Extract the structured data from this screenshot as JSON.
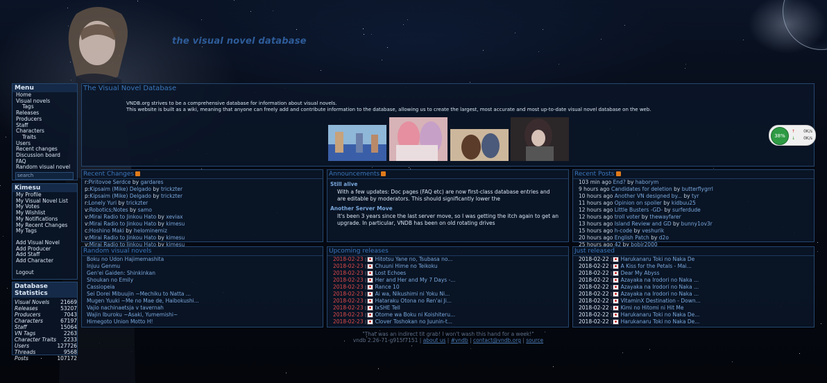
{
  "site_title": "the visual novel database",
  "menu": {
    "title": "Menu",
    "items": [
      {
        "label": "Home",
        "sub": false
      },
      {
        "label": "Visual novels",
        "sub": false
      },
      {
        "label": "Tags",
        "sub": true
      },
      {
        "label": "Releases",
        "sub": false
      },
      {
        "label": "Producers",
        "sub": false
      },
      {
        "label": "Staff",
        "sub": false
      },
      {
        "label": "Characters",
        "sub": false
      },
      {
        "label": "Traits",
        "sub": true
      },
      {
        "label": "Users",
        "sub": false
      },
      {
        "label": "Recent changes",
        "sub": false
      },
      {
        "label": "Discussion board",
        "sub": false
      },
      {
        "label": "FAQ",
        "sub": false
      },
      {
        "label": "Random visual novel",
        "sub": false
      }
    ],
    "search_placeholder": "search"
  },
  "user_menu": {
    "title": "Kimesu",
    "items": [
      "My Profile",
      "My Visual Novel List",
      "My Votes",
      "My Wishlist",
      "My Notifications",
      "My Recent Changes",
      "My Tags"
    ],
    "add_items": [
      "Add Visual Novel",
      "Add Producer",
      "Add Staff",
      "Add Character"
    ],
    "logout": "Logout"
  },
  "stats": {
    "title": "Database Statistics",
    "rows": [
      {
        "k": "Visual Novels",
        "v": "21669"
      },
      {
        "k": "Releases",
        "v": "53207"
      },
      {
        "k": "Producers",
        "v": "7043"
      },
      {
        "k": "Characters",
        "v": "67197"
      },
      {
        "k": "Staff",
        "v": "15064"
      },
      {
        "k": "VN Tags",
        "v": "2263"
      },
      {
        "k": "Character Traits",
        "v": "2233"
      },
      {
        "k": "Users",
        "v": "127726"
      },
      {
        "k": "Threads",
        "v": "9568"
      },
      {
        "k": "Posts",
        "v": "107172"
      }
    ]
  },
  "intro": {
    "title": "The Visual Novel Database",
    "line1": "VNDB.org strives to be a comprehensive database for information about visual novels.",
    "line2": "This website is built as a wiki, meaning that anyone can freely add and contribute information to the database, allowing us to create the largest, most accurate and most up-to-date visual novel database on the web."
  },
  "recent_changes": {
    "title": "Recent Changes",
    "rows": [
      {
        "prefix": "r:",
        "item": "Piritovoe Serdce",
        "user": "gardares"
      },
      {
        "prefix": "p:",
        "item": "Kipsaim (Mike) Delgado",
        "user": "trickzter"
      },
      {
        "prefix": "p:",
        "item": "Kipsaim (Mike) Delgado",
        "user": "trickzter"
      },
      {
        "prefix": "r:",
        "item": "Lonely Yuri",
        "user": "trickzter"
      },
      {
        "prefix": "v:",
        "item": "Robotics;Notes",
        "user": "samo"
      },
      {
        "prefix": "v:",
        "item": "Mirai Radio to Jinkou Hato",
        "user": "xeviax"
      },
      {
        "prefix": "v:",
        "item": "Mirai Radio to Jinkou Hato",
        "user": "kimesu"
      },
      {
        "prefix": "c:",
        "item": "Hoshino Maki",
        "user": "helominemiz"
      },
      {
        "prefix": "v:",
        "item": "Mirai Radio to Jinkou Hato",
        "user": "kimesu"
      },
      {
        "prefix": "v:",
        "item": "Mirai Radio to Jinkou Hato",
        "user": "kimesu"
      }
    ]
  },
  "announcements": {
    "title": "Announcements",
    "items": [
      {
        "title": "Still alive",
        "body": "With a few updates: Doc pages (FAQ etc) are now first-class database entries and are editable by moderators. This should significantly lower the"
      },
      {
        "title": "Another Server Move",
        "body": "It's been 3 years since the last server move, so I was getting the itch again to get an upgrade. In particular, VNDB has been on old rotating drives"
      }
    ]
  },
  "recent_posts": {
    "title": "Recent Posts",
    "rows": [
      {
        "time": "103 min ago",
        "topic": "End?",
        "user": "haborym"
      },
      {
        "time": "9 hours ago",
        "topic": "Candidates for deletion",
        "user": "butterflygrrl"
      },
      {
        "time": "10 hours ago",
        "topic": "Another VN designed by...",
        "user": "tyr"
      },
      {
        "time": "11 hours ago",
        "topic": "Opinion on spoiler",
        "user": "kidbuu25"
      },
      {
        "time": "12 hours ago",
        "topic": "Little Busters -GD-",
        "user": "surferdude"
      },
      {
        "time": "12 hours ago",
        "topic": "troll voter",
        "user": "thewayfarer"
      },
      {
        "time": "13 hours ago",
        "topic": "Island Review and GD",
        "user": "bunny1ov3r"
      },
      {
        "time": "15 hours ago",
        "topic": "h-code",
        "user": "veshurik"
      },
      {
        "time": "20 hours ago",
        "topic": "English Patch",
        "user": "d2o"
      },
      {
        "time": "25 hours ago",
        "topic": "42",
        "user": "bobjr2000"
      }
    ]
  },
  "random_vns": {
    "title": "Random visual novels",
    "rows": [
      "Boku no Udon Hajimemashita",
      "Injuu Genmu",
      "Gen'ei Gaiden: Shinkinkan",
      "Shoukan no Emily",
      "Cassiopeia",
      "Sei Dorei Mibuujin ~Mechiku to Natta ...",
      "Mugen Yuuki ~Me no Mae de, Haibokushi...",
      "Vajio nachinaetsja v tavernah",
      "Wajin Iburoku ~Asaki, Yumemishi~",
      "Himegoto Union Motto H!"
    ]
  },
  "upcoming": {
    "title": "Upcoming releases",
    "rows": [
      {
        "date": "2018-02-23",
        "title": "Hitotsu Yane no, Tsubasa no..."
      },
      {
        "date": "2018-02-23",
        "title": "Chuuni Hime no Teikoku"
      },
      {
        "date": "2018-02-23",
        "title": "Lost Echoes"
      },
      {
        "date": "2018-02-23",
        "title": "Her and Her and My 7 Days -..."
      },
      {
        "date": "2018-02-23",
        "title": "Rance 10"
      },
      {
        "date": "2018-02-23",
        "title": "Ai wa, Nikushimi ni Yoku Ni..."
      },
      {
        "date": "2018-02-23",
        "title": "Hataraku Otona no Ren'ai Ji..."
      },
      {
        "date": "2018-02-23",
        "title": "IxSHE Tell"
      },
      {
        "date": "2018-02-23",
        "title": "Otome wa Boku ni Koishiteru..."
      },
      {
        "date": "2018-02-23",
        "title": "Clover Toshokan no Juunin-t..."
      }
    ]
  },
  "just_released": {
    "title": "Just released",
    "rows": [
      {
        "date": "2018-02-22",
        "title": "Harukanaru Toki no Naka De"
      },
      {
        "date": "2018-02-22",
        "title": "A Kiss for the Petals - Mai..."
      },
      {
        "date": "2018-02-22",
        "title": "Dear My Abyss"
      },
      {
        "date": "2018-02-22",
        "title": "Azayaka na Irodori no Naka ..."
      },
      {
        "date": "2018-02-22",
        "title": "Azayaka na Irodori no Naka ..."
      },
      {
        "date": "2018-02-22",
        "title": "Azayaka na Irodori no Naka ..."
      },
      {
        "date": "2018-02-22",
        "title": "VitaminX Destination - Down..."
      },
      {
        "date": "2018-02-22",
        "title": "Kimi no Hitomi ni Hit Me"
      },
      {
        "date": "2018-02-22",
        "title": "Harukanaru Toki no Naka De..."
      },
      {
        "date": "2018-02-22",
        "title": "Harukanaru Toki no Naka De..."
      }
    ]
  },
  "footer": {
    "quote": "\"That was an indirect tit grab! I won't wash this hand for a week!\"",
    "version": "vndb 2.26-71-g915f7151",
    "links": [
      "about us",
      "#vndb",
      "contact@vndb.org",
      "source"
    ]
  },
  "net_widget": {
    "percent": "38%",
    "up": "0K/s",
    "down": "0K/s"
  },
  "colors": {
    "accent": "#3b76ba",
    "link": "#7aa8dc",
    "border": "#25476f",
    "upcoming_date": "#e14a4a"
  }
}
